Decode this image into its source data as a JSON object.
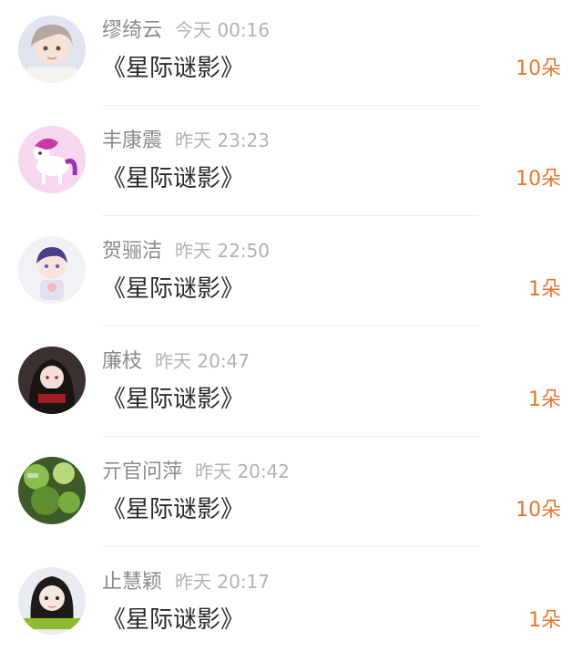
{
  "records": [
    {
      "name": "缪绮云",
      "time": "今天 00:16",
      "title": "《星际谜影》",
      "amount": "10朵",
      "avatar": "avatar-girl-light-hair"
    },
    {
      "name": "丰康震",
      "time": "昨天 23:23",
      "title": "《星际谜影》",
      "amount": "10朵",
      "avatar": "avatar-pink-pony"
    },
    {
      "name": "贺骊洁",
      "time": "昨天 22:50",
      "title": "《星际谜影》",
      "amount": "1朵",
      "avatar": "avatar-anime-boy"
    },
    {
      "name": "廉枝",
      "time": "昨天 20:47",
      "title": "《星际谜影》",
      "amount": "1朵",
      "avatar": "avatar-dark-anime-girl"
    },
    {
      "name": "亓官问萍",
      "time": "昨天 20:42",
      "title": "《星际谜影》",
      "amount": "10朵",
      "avatar": "avatar-green-plants"
    },
    {
      "name": "止慧颖",
      "time": "昨天 20:17",
      "title": "《星际谜影》",
      "amount": "1朵",
      "avatar": "avatar-girl-dark-hair"
    }
  ],
  "colors": {
    "amount": "#e8762c",
    "name": "#8a8a8a",
    "time": "#b2b2b2",
    "title": "#2b2b2b",
    "divider": "#ececec"
  }
}
